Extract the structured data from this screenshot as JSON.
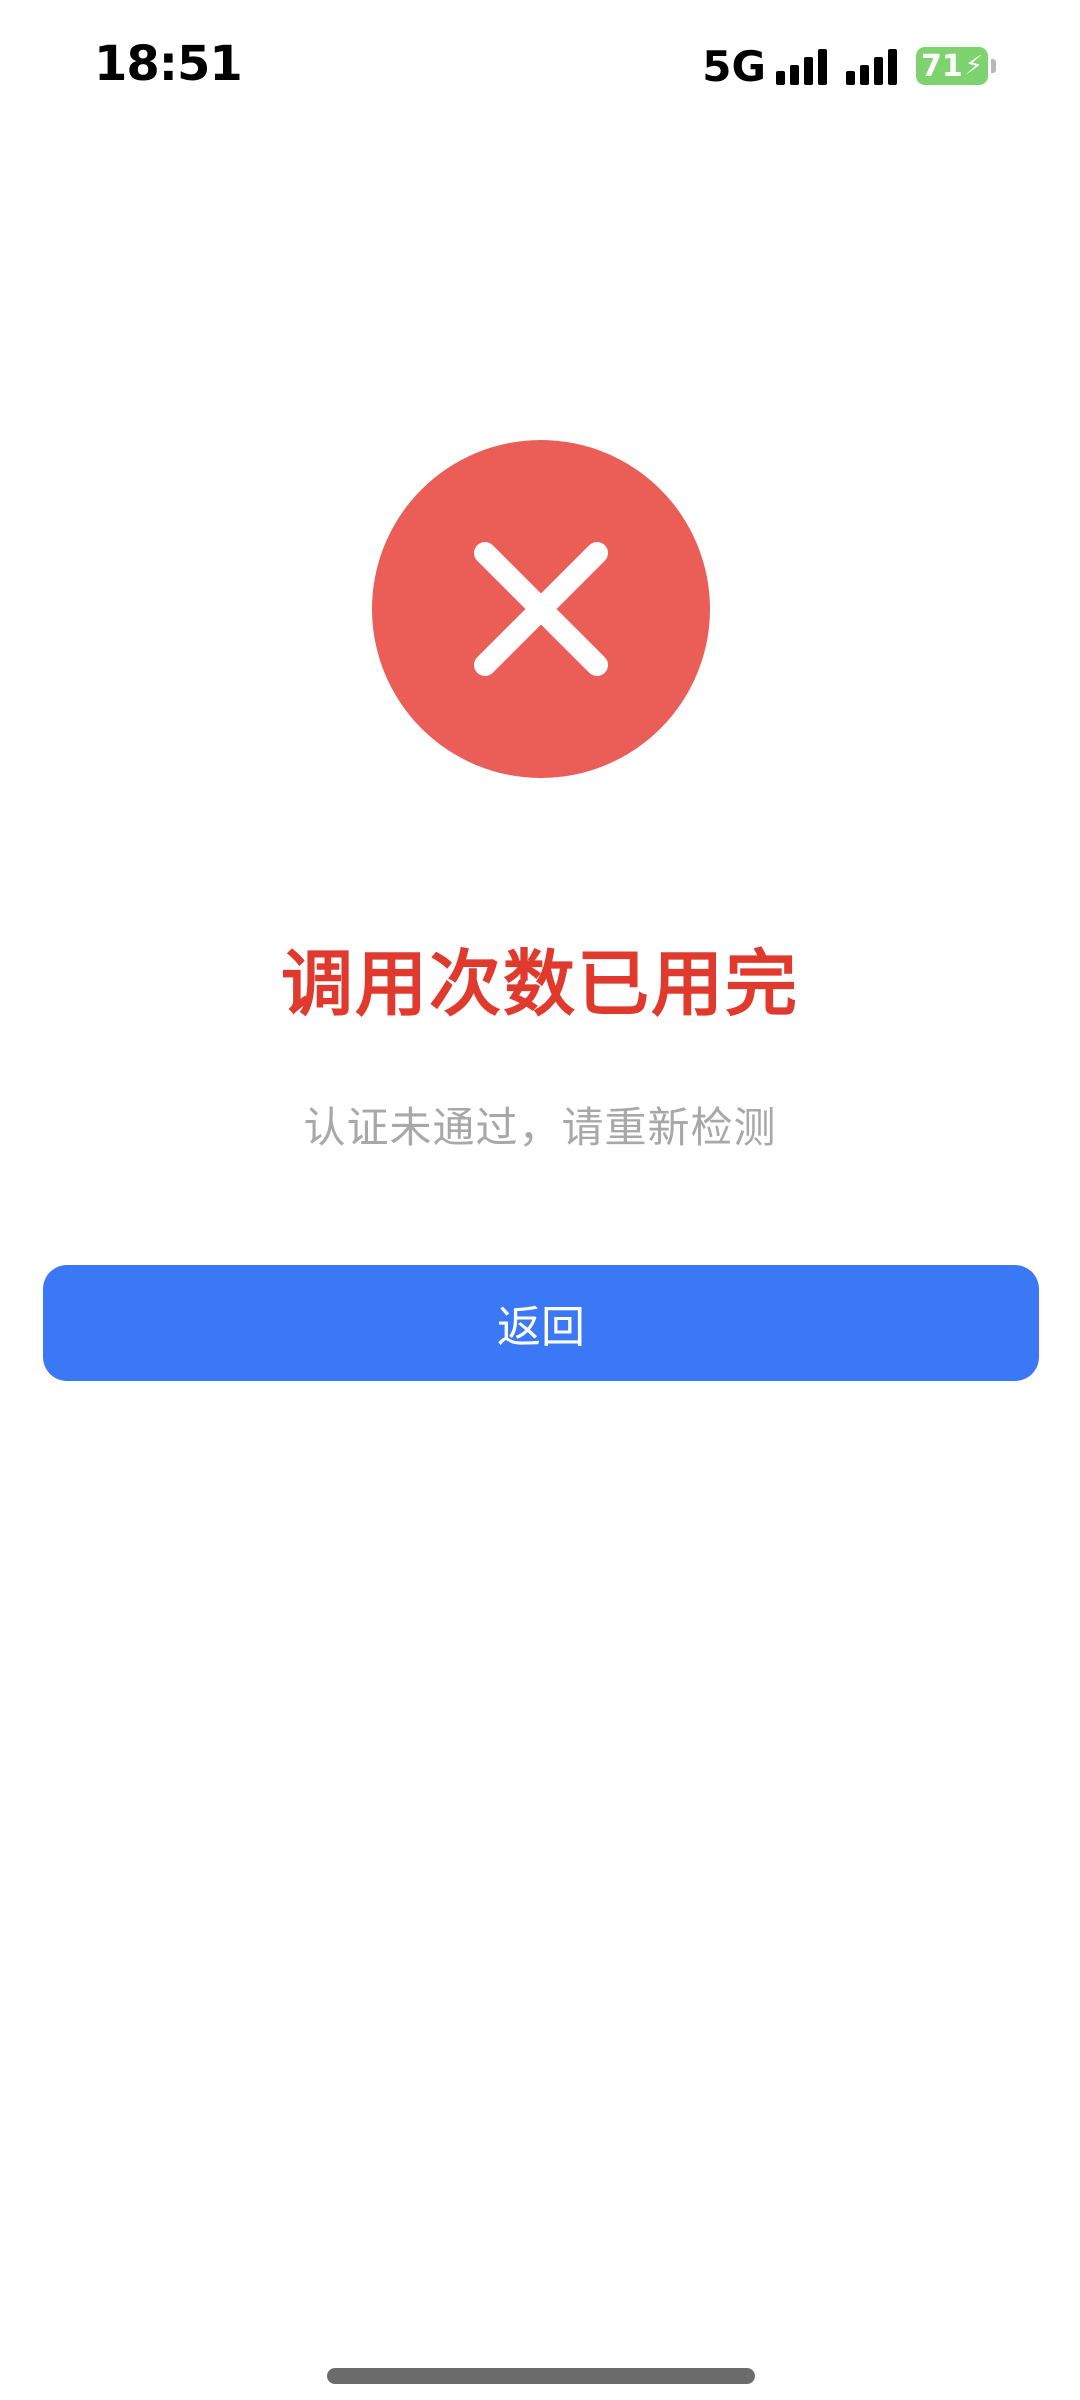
{
  "status_bar": {
    "time": "18:51",
    "network": "5G",
    "battery_level": "71",
    "signal_icon_1": "cellular-signal-icon",
    "signal_icon_2": "cellular-signal-icon",
    "charging_icon": "charging-bolt-icon"
  },
  "result": {
    "icon": "error-x-icon",
    "icon_color": "#eb5e58",
    "title": "调用次数已用完",
    "title_color": "#e03a2f",
    "subtitle": "认证未通过，请重新检测"
  },
  "actions": {
    "back_label": "返回",
    "back_color": "#3b78f6"
  }
}
